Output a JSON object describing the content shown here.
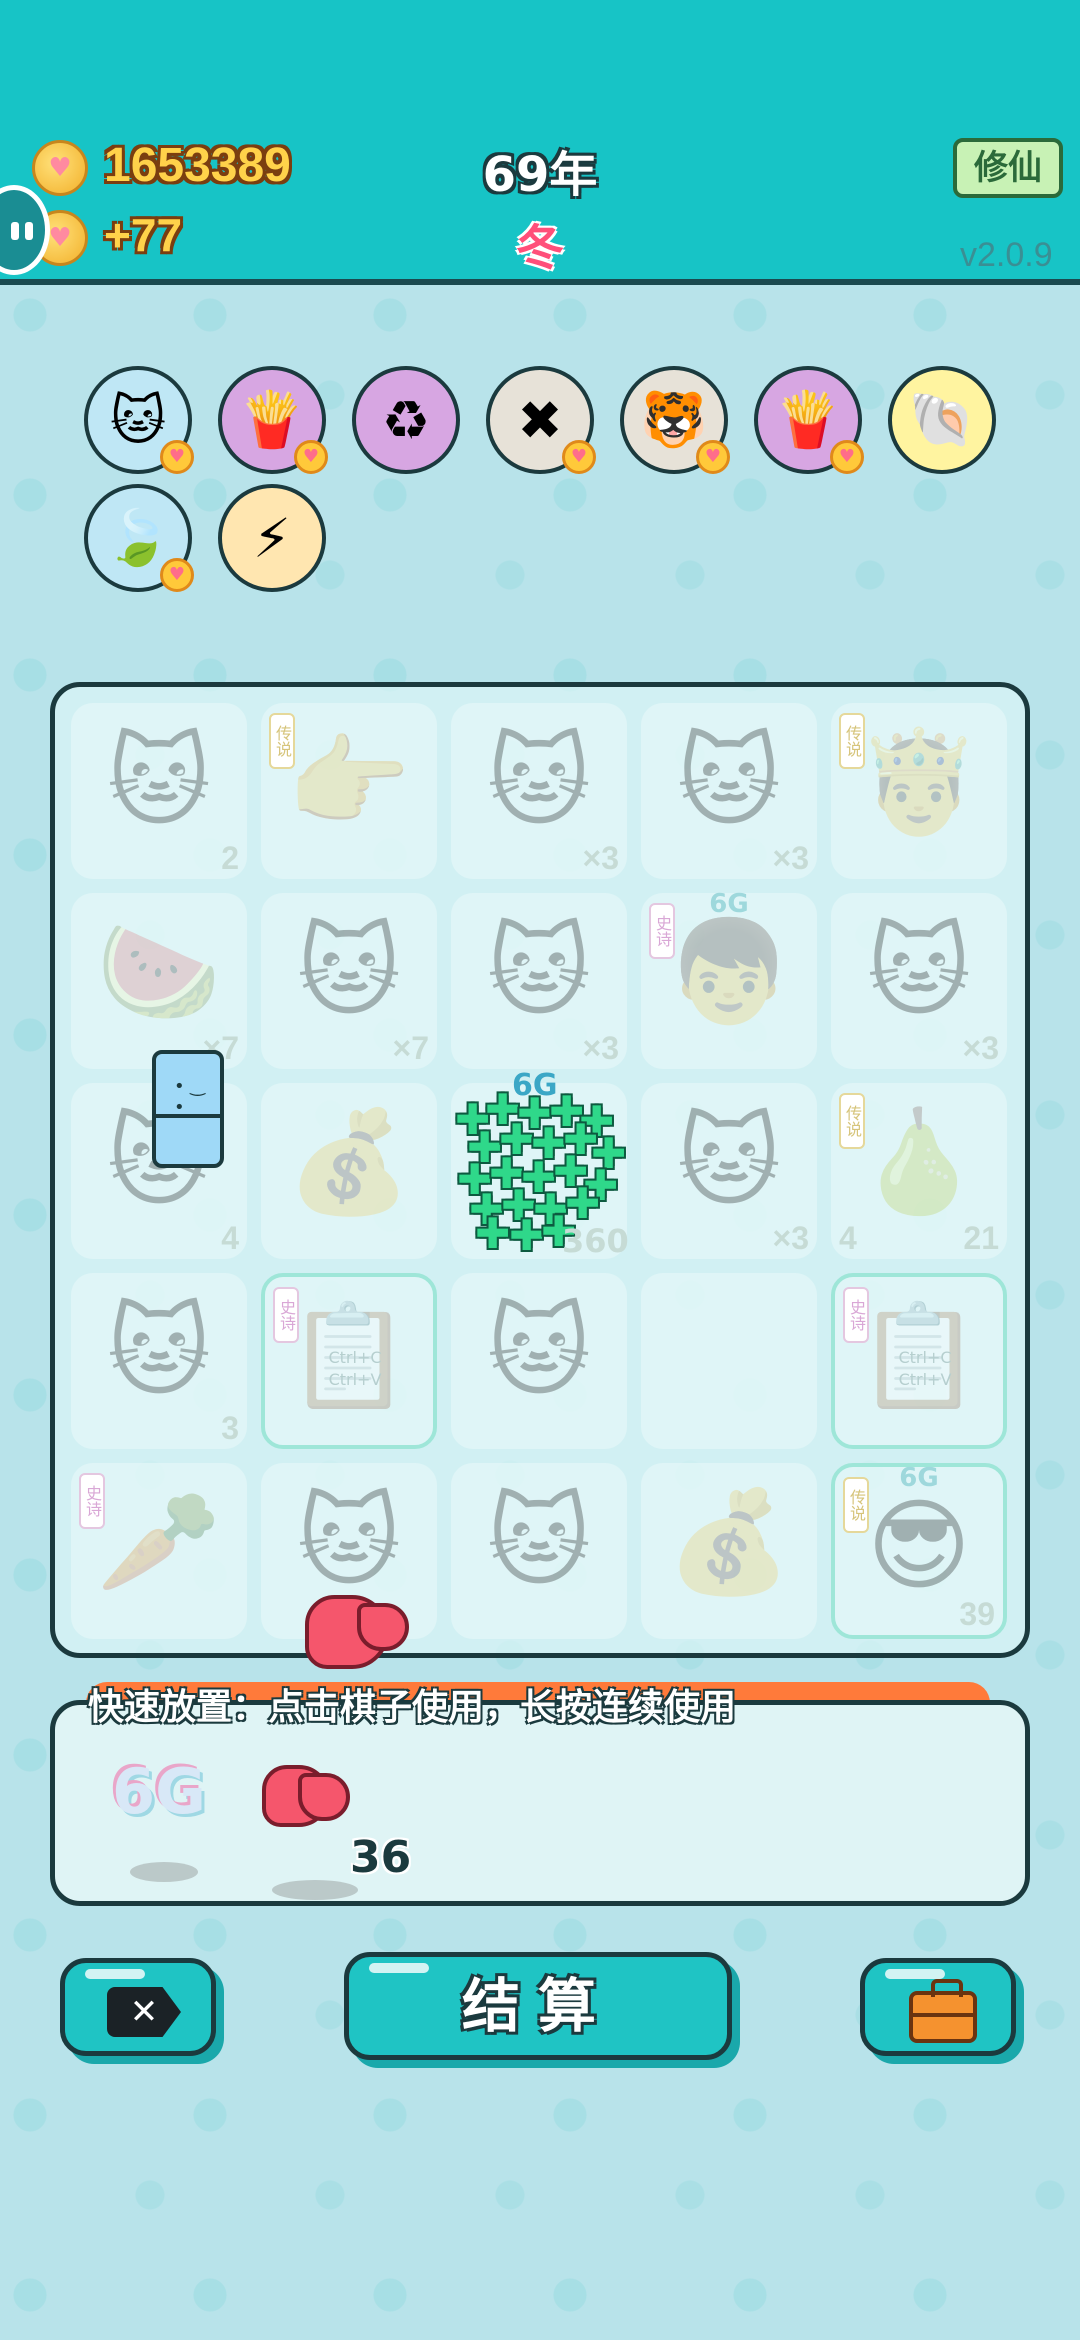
{
  "header": {
    "coins": "1653389",
    "coin_gain": "+77",
    "year": "69年",
    "season": "冬",
    "cultivate_button": "修仙",
    "version": "v2.0.9"
  },
  "items": [
    {
      "name": "cat-with-heart",
      "icon": "🐱",
      "bg": "#bfe7f5",
      "badge": true
    },
    {
      "name": "fries-with-heart",
      "icon": "🍟",
      "bg": "#d7a6e2",
      "badge": true
    },
    {
      "name": "recycle",
      "icon": "♻",
      "bg": "#d7a6e2",
      "badge": false
    },
    {
      "name": "delete-tag-with-heart",
      "icon": "✖",
      "bg": "#e7e2d8",
      "badge": true
    },
    {
      "name": "tiger-faces",
      "icon": "🐯",
      "bg": "#e7e2d8",
      "badge": true
    },
    {
      "name": "fries-with-heart-2",
      "icon": "🍟",
      "bg": "#d7a6e2",
      "badge": true
    },
    {
      "name": "shell",
      "icon": "🐚",
      "bg": "#fff4a0",
      "badge": false
    },
    {
      "name": "leaf-with-heart",
      "icon": "🍃",
      "bg": "#bfe7f5",
      "badge": true
    },
    {
      "name": "lightning",
      "icon": "⚡",
      "bg": "#ffe6b0",
      "badge": false
    }
  ],
  "board": {
    "cells": [
      {
        "icon": "🐱",
        "count": "2"
      },
      {
        "icon": "👉",
        "count": "",
        "tag": "传说"
      },
      {
        "icon": "🐱",
        "count": "×3"
      },
      {
        "icon": "🐱",
        "count": "×3"
      },
      {
        "icon": "🤴",
        "count": "",
        "tag": "传说"
      },
      {
        "icon": "🍉",
        "count": "×7"
      },
      {
        "icon": "🐱",
        "count": "×7"
      },
      {
        "icon": "🐱",
        "count": "×3"
      },
      {
        "icon": "👦",
        "count": "",
        "tag": "史诗",
        "g6": "6G"
      },
      {
        "icon": "🐱",
        "count": "×3"
      },
      {
        "icon": "🐱",
        "count": "4"
      },
      {
        "icon": "💰",
        "count": ""
      },
      {
        "icon": "",
        "count": ""
      },
      {
        "icon": "🐱",
        "count": "×3"
      },
      {
        "icon": "🍐",
        "count": "21",
        "left_count": "4",
        "tag": "传说"
      },
      {
        "icon": "🐱",
        "count": "3"
      },
      {
        "icon": "📋",
        "count": "",
        "tag": "史诗",
        "highlight": true,
        "copy": "Ctrl+C Ctrl+V"
      },
      {
        "icon": "🐱",
        "count": ""
      },
      {
        "icon": "",
        "count": ""
      },
      {
        "icon": "📋",
        "count": "",
        "tag": "史诗",
        "highlight": true,
        "copy": "Ctrl+C Ctrl+V"
      },
      {
        "icon": "🥕",
        "count": "",
        "tag": "史诗"
      },
      {
        "icon": "🐱",
        "count": ""
      },
      {
        "icon": "🐱",
        "count": ""
      },
      {
        "icon": "💰",
        "count": ""
      },
      {
        "icon": "😎",
        "count": "39",
        "tag": "传说",
        "g6": "6G",
        "highlight": true
      }
    ],
    "center_label": "6G",
    "center_count": "360"
  },
  "hint": "快速放置：点击棋子使用，长按连续使用",
  "tray": {
    "item_6g": "6G",
    "liver_count": "36"
  },
  "buttons": {
    "settle": "结算"
  }
}
